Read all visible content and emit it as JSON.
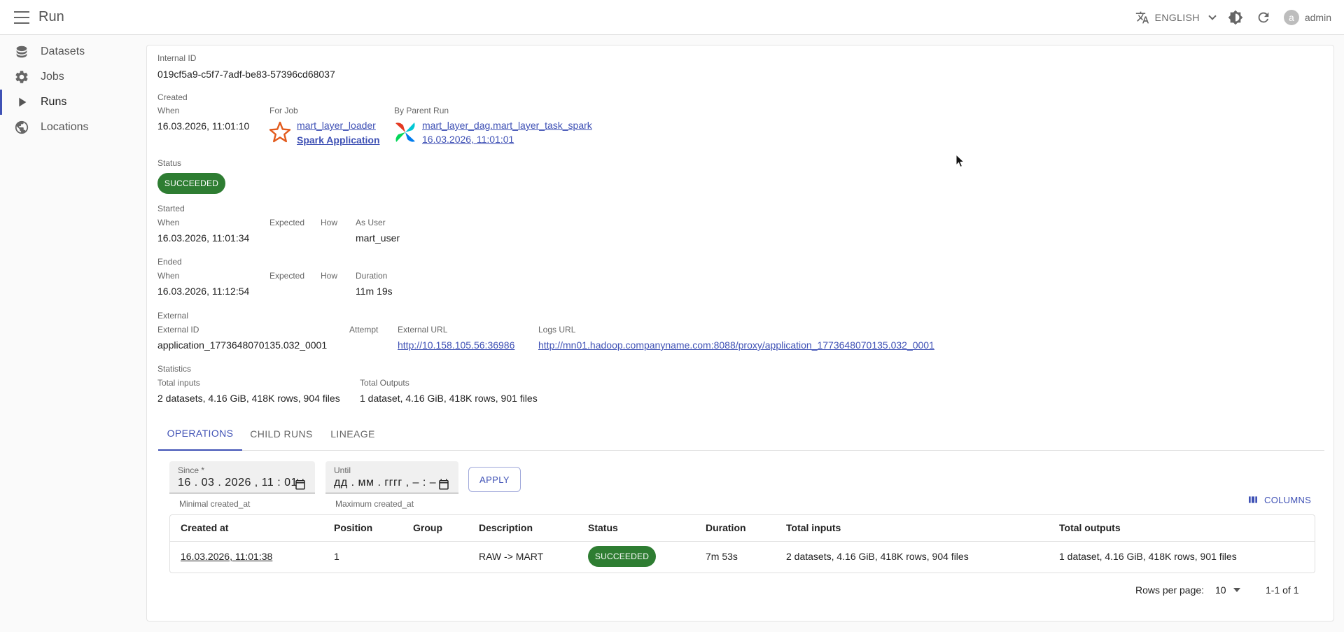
{
  "app": {
    "title": "Run",
    "language": "ENGLISH",
    "user_initial": "a",
    "user_name": "admin"
  },
  "sidebar": {
    "items": [
      {
        "label": "Datasets",
        "icon": "database-icon"
      },
      {
        "label": "Jobs",
        "icon": "gear-icon"
      },
      {
        "label": "Runs",
        "icon": "play-icon",
        "active": true
      },
      {
        "label": "Locations",
        "icon": "globe-icon"
      }
    ]
  },
  "run": {
    "internal_id_label": "Internal ID",
    "internal_id": "019cf5a9-c5f7-7adf-be83-57396cd68037",
    "created_label": "Created",
    "created_when_label": "When",
    "created_when": "16.03.2026, 11:01:10",
    "for_job_label": "For Job",
    "job_name": "mart_layer_loader",
    "job_type": "Spark Application",
    "parent_run_label": "By Parent Run",
    "parent_run_name": "mart_layer_dag.mart_layer_task_spark",
    "parent_run_time": "16.03.2026, 11:01:01",
    "status_label": "Status",
    "status": "SUCCEEDED",
    "started_label": "Started",
    "started_when_label": "When",
    "started_when": "16.03.2026, 11:01:34",
    "started_expected_label": "Expected",
    "started_how_label": "How",
    "as_user_label": "As User",
    "as_user": "mart_user",
    "ended_label": "Ended",
    "ended_when_label": "When",
    "ended_when": "16.03.2026, 11:12:54",
    "ended_expected_label": "Expected",
    "ended_how_label": "How",
    "duration_label": "Duration",
    "duration": "11m 19s",
    "external_label": "External",
    "external_id_label": "External ID",
    "external_id": "application_1773648070135.032_0001",
    "attempt_label": "Attempt",
    "external_url_label": "External URL",
    "external_url": "http://10.158.105.56:36986",
    "logs_url_label": "Logs URL",
    "logs_url": "http://mn01.hadoop.companyname.com:8088/proxy/application_1773648070135.032_0001",
    "statistics_label": "Statistics",
    "total_inputs_label": "Total inputs",
    "total_inputs": "2 datasets, 4.16 GiB, 418K rows, 904 files",
    "total_outputs_label": "Total Outputs",
    "total_outputs": "1 dataset, 4.16 GiB, 418K rows, 901 files"
  },
  "tabs": [
    "OPERATIONS",
    "CHILD RUNS",
    "LINEAGE"
  ],
  "filters": {
    "since_label": "Since *",
    "since_value": "16 . 03 . 2026 ,  11 : 01",
    "since_helper": "Minimal created_at",
    "until_label": "Until",
    "until_value": "дд . мм . гггг ,  – : –",
    "until_helper": "Maximum created_at",
    "apply_label": "APPLY",
    "columns_label": "COLUMNS"
  },
  "table": {
    "headers": [
      "Created at",
      "Position",
      "Group",
      "Description",
      "Status",
      "Duration",
      "Total inputs",
      "Total outputs"
    ],
    "rows": [
      {
        "created_at": "16.03.2026, 11:01:38",
        "position": "1",
        "group": "",
        "description": "RAW -> MART",
        "status": "SUCCEEDED",
        "duration": "7m 53s",
        "total_inputs": "2 datasets, 4.16 GiB, 418K rows, 904 files",
        "total_outputs": "1 dataset, 4.16 GiB, 418K rows, 901 files"
      }
    ]
  },
  "pagination": {
    "rows_per_page_label": "Rows per page:",
    "rows_per_page": "10",
    "range": "1-1 of 1"
  },
  "colors": {
    "accent": "#3f51b5",
    "success": "#2e7d32"
  }
}
